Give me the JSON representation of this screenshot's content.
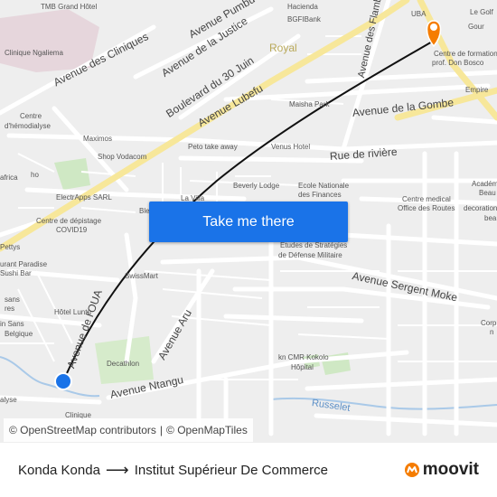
{
  "map": {
    "streets": {
      "cliniques": "Avenue des Cliniques",
      "justice": "Avenue de la Justice",
      "trente_juin": "Boulevard du 30 Juin",
      "lubefu": "Avenue Lubefu",
      "gombe": "Avenue de la Gombe",
      "riviere": "Rue de rivière",
      "flambeaux": "Avenue des Flamboyants",
      "sergent_moke": "Avenue Sergent Moke",
      "aru": "Avenue Aru",
      "ntangu": "Avenue Ntangu",
      "oua": "Avenue de l'OUA",
      "pumbu": "Avenue Pumbu",
      "russelet": "Russelet",
      "royal": "Royal"
    },
    "places": {
      "tmb": "TMB Grand Hôtel",
      "ngaliema": "Clinique Ngaliema",
      "hacienda": "Hacienda",
      "bgfi": "BGFIBank",
      "uba": "UBA",
      "centre_formation_1": "Centre de formation",
      "centre_formation_2": "prof. Don Bosco",
      "empire": "Empire",
      "golf": "Le Golf",
      "gour": "Gour",
      "hemodialyse_1": "Centre",
      "hemodialyse_2": "d'hémodialyse",
      "maximos": "Maximos",
      "maisha": "Maisha Park",
      "peto": "Peto take away",
      "venus": "Venus Hotel",
      "shop_vodacom": "Shop Vodacom",
      "africa": "africa",
      "ho": "ho",
      "electrapps": "ElectrApps SARL",
      "beverly": "Beverly Lodge",
      "ecole_1": "Ecole Nationale",
      "ecole_2": "des Finances",
      "la_villa": "La Villa",
      "ble": "Ble",
      "depistage_1": "Centre de dépistage",
      "depistage_2": "COVID19",
      "etudes_1": "Etudes de Stratégies",
      "etudes_2": "de Défense Militaire",
      "petty": "Pettys",
      "paradise": "urant Paradise",
      "sushi": "Sushi Bar",
      "swissmart": "SwissMart",
      "medical_1": "Centre medical",
      "medical_2": "Office des Routes",
      "academie_1": "Académ",
      "academie_2": "Beau",
      "decoration_1": "decoration",
      "decoration_2": "bea",
      "sans_1": "sans",
      "sans_2": "res",
      "hotel_luntu": "Hôtel Luntu",
      "sansbelg_1": "in Sans",
      "sansbelg_2": "Belgique",
      "decathlon": "Decathlon",
      "kn_1": "kn CMR Kokolo",
      "kn_2": "Hôpital",
      "corp_1": "Corp",
      "corp_2": "n",
      "alyse": "alyse",
      "clinique": "Clinique"
    },
    "route_color": "#111111",
    "origin_color": "#1a73e8",
    "destination_color": "#f57c00"
  },
  "cta": {
    "label": "Take me there"
  },
  "attribution": {
    "osm": "© OpenStreetMap contributors",
    "sep": "|",
    "omt": "© OpenMapTiles"
  },
  "footer": {
    "origin": "Konda Konda",
    "arrow": "⟶",
    "destination": "Institut Supérieur De Commerce",
    "brand": "moovit"
  }
}
